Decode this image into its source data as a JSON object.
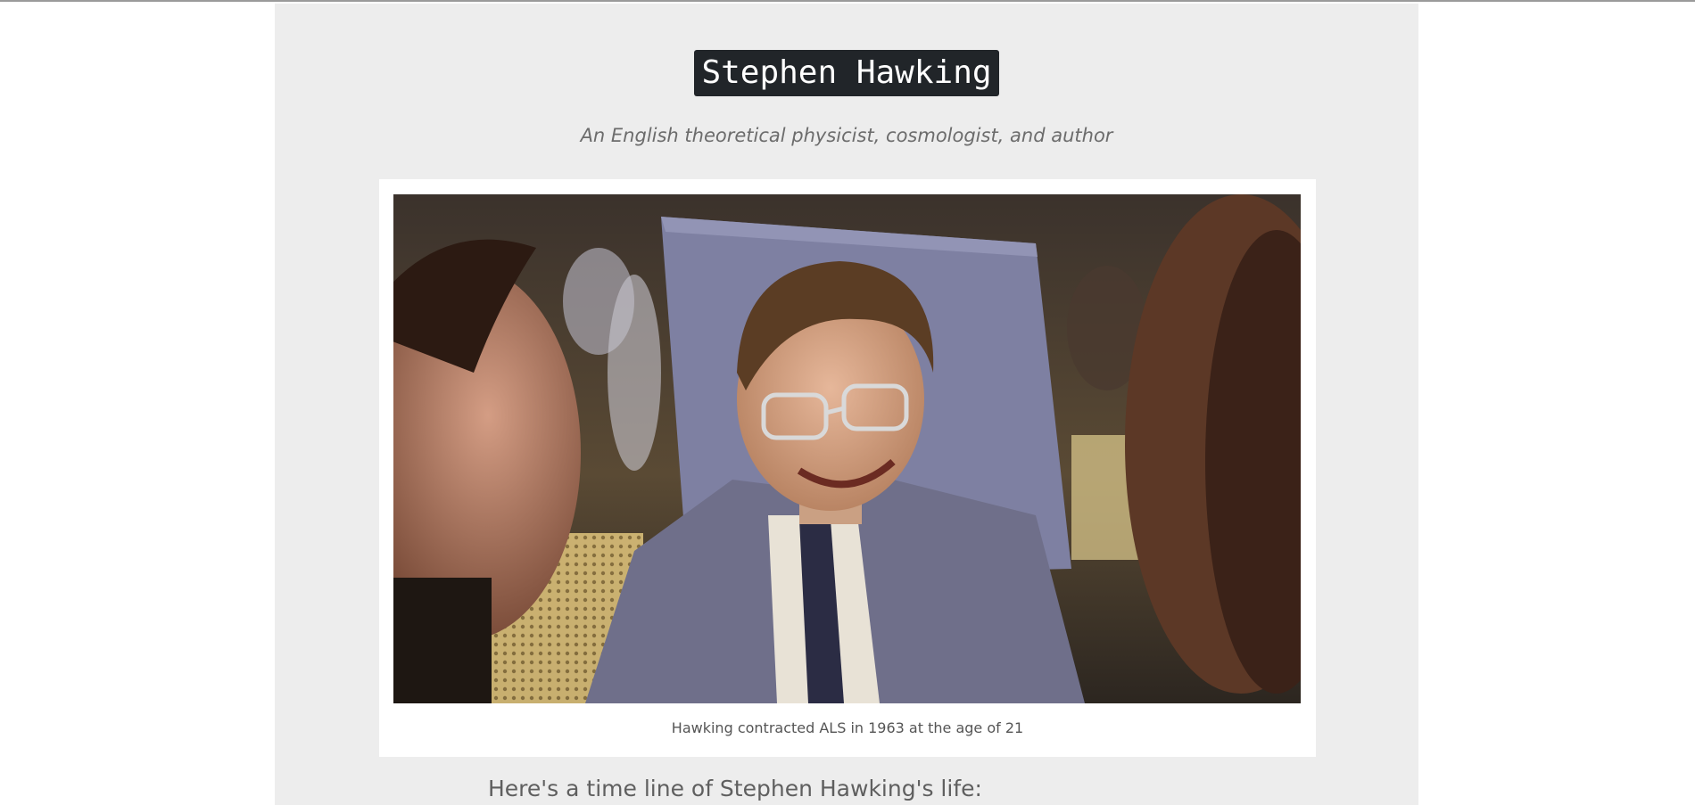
{
  "header": {
    "title": "Stephen Hawking",
    "subtitle": "An English theoretical physicist, cosmologist, and author"
  },
  "figure": {
    "caption": "Hawking contracted ALS in 1963 at the age of 21"
  },
  "timeline": {
    "heading": "Here's a time line of Stephen Hawking's life:"
  },
  "colors": {
    "panel_background": "#ededed",
    "title_background": "#212529",
    "title_text": "#ffffff",
    "subtitle_text": "#6c6c6c"
  }
}
